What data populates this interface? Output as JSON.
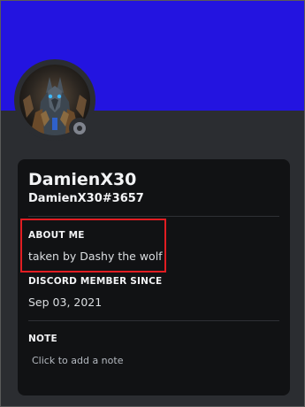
{
  "colors": {
    "banner": "#2314e0",
    "background": "#2b2d31",
    "card": "#111214",
    "highlight": "#e11d22",
    "status_offline": "#80848e"
  },
  "profile": {
    "display_name": "DamienX30",
    "username": "DamienX30#3657",
    "avatar_icon": "wolf-avatar",
    "status": "offline"
  },
  "about": {
    "title": "ABOUT ME",
    "text": "taken by Dashy the wolf"
  },
  "member_since": {
    "title": "DISCORD MEMBER SINCE",
    "date": "Sep 03, 2021"
  },
  "note": {
    "title": "NOTE",
    "placeholder": "Click to add a note"
  }
}
